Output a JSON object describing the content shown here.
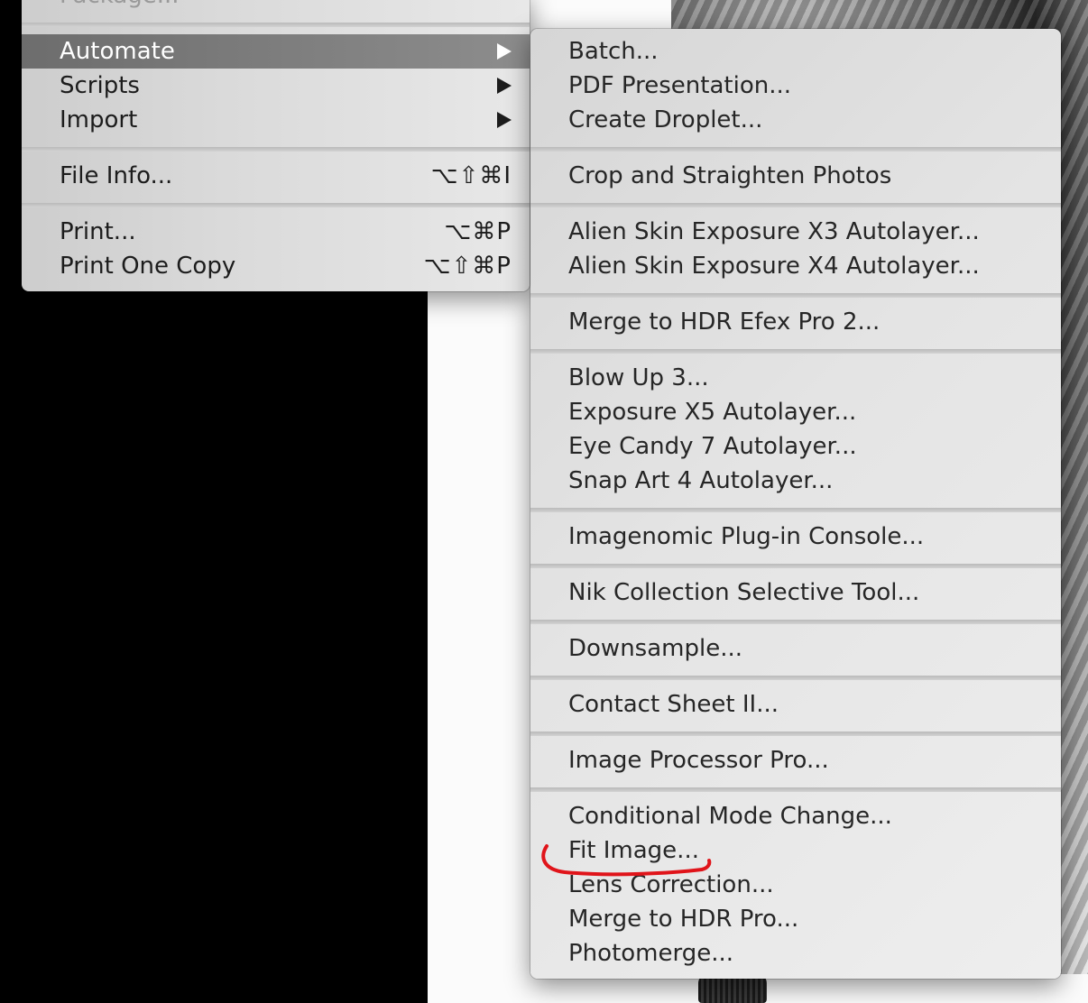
{
  "main_menu": {
    "items": [
      {
        "label": "Package..."
      },
      {
        "label": "Automate"
      },
      {
        "label": "Scripts"
      },
      {
        "label": "Import"
      },
      {
        "label": "File Info...",
        "shortcut": "⌥⇧⌘I"
      },
      {
        "label": "Print...",
        "shortcut": "⌥⌘P"
      },
      {
        "label": "Print One Copy",
        "shortcut": "⌥⇧⌘P"
      }
    ]
  },
  "automate_submenu": {
    "items": [
      {
        "label": "Batch..."
      },
      {
        "label": "PDF Presentation..."
      },
      {
        "label": "Create Droplet..."
      },
      {
        "label": "Crop and Straighten Photos"
      },
      {
        "label": "Alien Skin Exposure X3 Autolayer..."
      },
      {
        "label": "Alien Skin Exposure X4 Autolayer..."
      },
      {
        "label": "Merge to HDR Efex Pro 2..."
      },
      {
        "label": "Blow Up 3..."
      },
      {
        "label": "Exposure X5 Autolayer..."
      },
      {
        "label": "Eye Candy 7 Autolayer..."
      },
      {
        "label": "Snap Art 4 Autolayer..."
      },
      {
        "label": "Imagenomic Plug-in Console..."
      },
      {
        "label": "Nik Collection Selective Tool..."
      },
      {
        "label": "Downsample..."
      },
      {
        "label": "Contact Sheet II..."
      },
      {
        "label": "Image Processor Pro..."
      },
      {
        "label": "Conditional Mode Change..."
      },
      {
        "label": "Fit Image..."
      },
      {
        "label": "Lens Correction..."
      },
      {
        "label": "Merge to HDR Pro..."
      },
      {
        "label": "Photomerge..."
      }
    ]
  },
  "colors": {
    "highlight": "#7a7a7a",
    "annotation": "#e0141a"
  }
}
